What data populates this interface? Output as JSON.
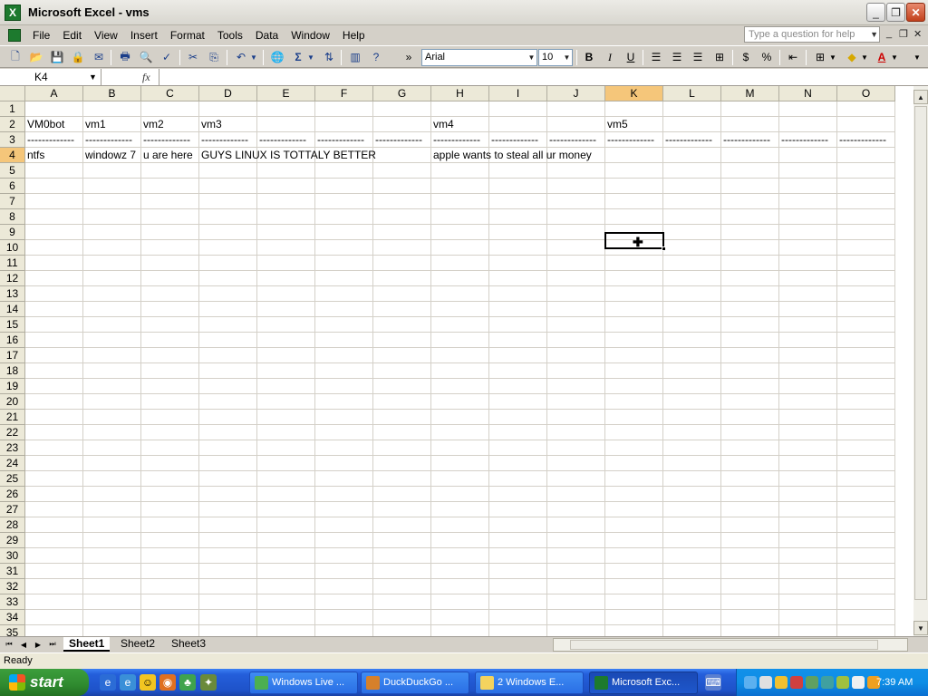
{
  "window": {
    "title": "Microsoft Excel - vms",
    "app_icon": "excel-icon"
  },
  "menu": {
    "items": [
      "File",
      "Edit",
      "View",
      "Insert",
      "Format",
      "Tools",
      "Data",
      "Window",
      "Help"
    ],
    "help_placeholder": "Type a question for help"
  },
  "toolbar": {
    "font_name": "Arial",
    "font_size": "10",
    "bold": "B",
    "italic": "I",
    "underline": "U",
    "currency": "$",
    "percent": "%",
    "sum": "Σ",
    "overflow": "»"
  },
  "formula": {
    "cell_ref": "K4",
    "fx": "fx",
    "value": ""
  },
  "grid": {
    "columns": [
      "A",
      "B",
      "C",
      "D",
      "E",
      "F",
      "G",
      "H",
      "I",
      "J",
      "K",
      "L",
      "M",
      "N",
      "O"
    ],
    "selected_column": "K",
    "rows": [
      "1",
      "2",
      "3",
      "4",
      "5",
      "6",
      "7",
      "8",
      "9",
      "10",
      "11",
      "12",
      "13",
      "14",
      "15",
      "16",
      "17",
      "18",
      "19",
      "20",
      "21",
      "22",
      "23",
      "24",
      "25",
      "26",
      "27",
      "28",
      "29",
      "30",
      "31",
      "32",
      "33",
      "34",
      "35"
    ],
    "selected_row": "4",
    "cells": {
      "A2": "VM0bot",
      "B2": "vm1",
      "C2": "vm2",
      "D2": "vm3",
      "H2": "vm4",
      "K2": "vm5",
      "A3": "-------------",
      "B3": "-------------",
      "C3": "-------------",
      "D3": "-------------",
      "E3": "-------------",
      "F3": "-------------",
      "G3": "-------------",
      "H3": "-------------",
      "I3": "-------------",
      "J3": "-------------",
      "K3": "-------------",
      "L3": "-------------",
      "M3": "-------------",
      "N3": "-------------",
      "O3": "-------------",
      "A4": "ntfs",
      "B4": "windowz 7",
      "C4": "u are here",
      "D4": "GUYS LINUX IS TOTTALY BETTER",
      "H4": "apple wants to steal all ur money"
    }
  },
  "sheets": {
    "tabs": [
      "Sheet1",
      "Sheet2",
      "Sheet3"
    ],
    "active": "Sheet1"
  },
  "status": {
    "text": "Ready"
  },
  "taskbar": {
    "start_label": "start",
    "tasks": [
      {
        "label": "Windows Live ...",
        "active": false
      },
      {
        "label": "DuckDuckGo ...",
        "active": false
      },
      {
        "label": "2 Windows E...",
        "active": false
      },
      {
        "label": "Microsoft Exc...",
        "active": true
      }
    ],
    "clock": "7:39 AM"
  }
}
